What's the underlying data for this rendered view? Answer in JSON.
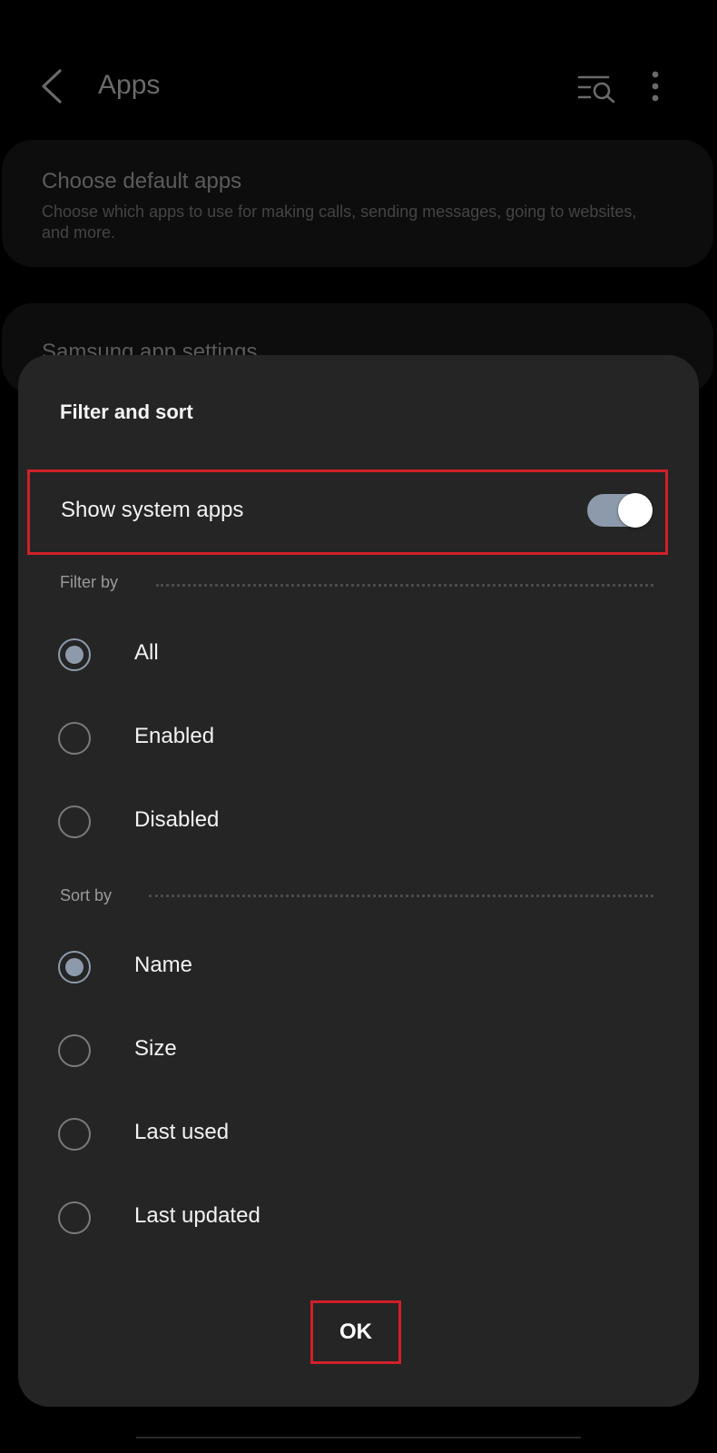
{
  "header": {
    "title": "Apps",
    "back_icon": "chevron-left-icon",
    "search_icon": "filter-search-icon",
    "more_icon": "more-vertical-icon"
  },
  "background_cards": [
    {
      "title": "Choose default apps",
      "subtitle": "Choose which apps to use for making calls, sending messages, going to websites, and more."
    },
    {
      "title": "Samsung app settings"
    }
  ],
  "dialog": {
    "title": "Filter and sort",
    "toggle": {
      "label": "Show system apps",
      "state": "on"
    },
    "filter_section": {
      "label": "Filter by",
      "options": [
        {
          "label": "All",
          "selected": true
        },
        {
          "label": "Enabled",
          "selected": false
        },
        {
          "label": "Disabled",
          "selected": false
        }
      ]
    },
    "sort_section": {
      "label": "Sort by",
      "options": [
        {
          "label": "Name",
          "selected": true
        },
        {
          "label": "Size",
          "selected": false
        },
        {
          "label": "Last used",
          "selected": false
        },
        {
          "label": "Last updated",
          "selected": false
        }
      ]
    },
    "ok_label": "OK"
  },
  "colors": {
    "background": "#000000",
    "sheet": "#252525",
    "accent": "#8d9aab",
    "highlight": "#d0202a"
  }
}
